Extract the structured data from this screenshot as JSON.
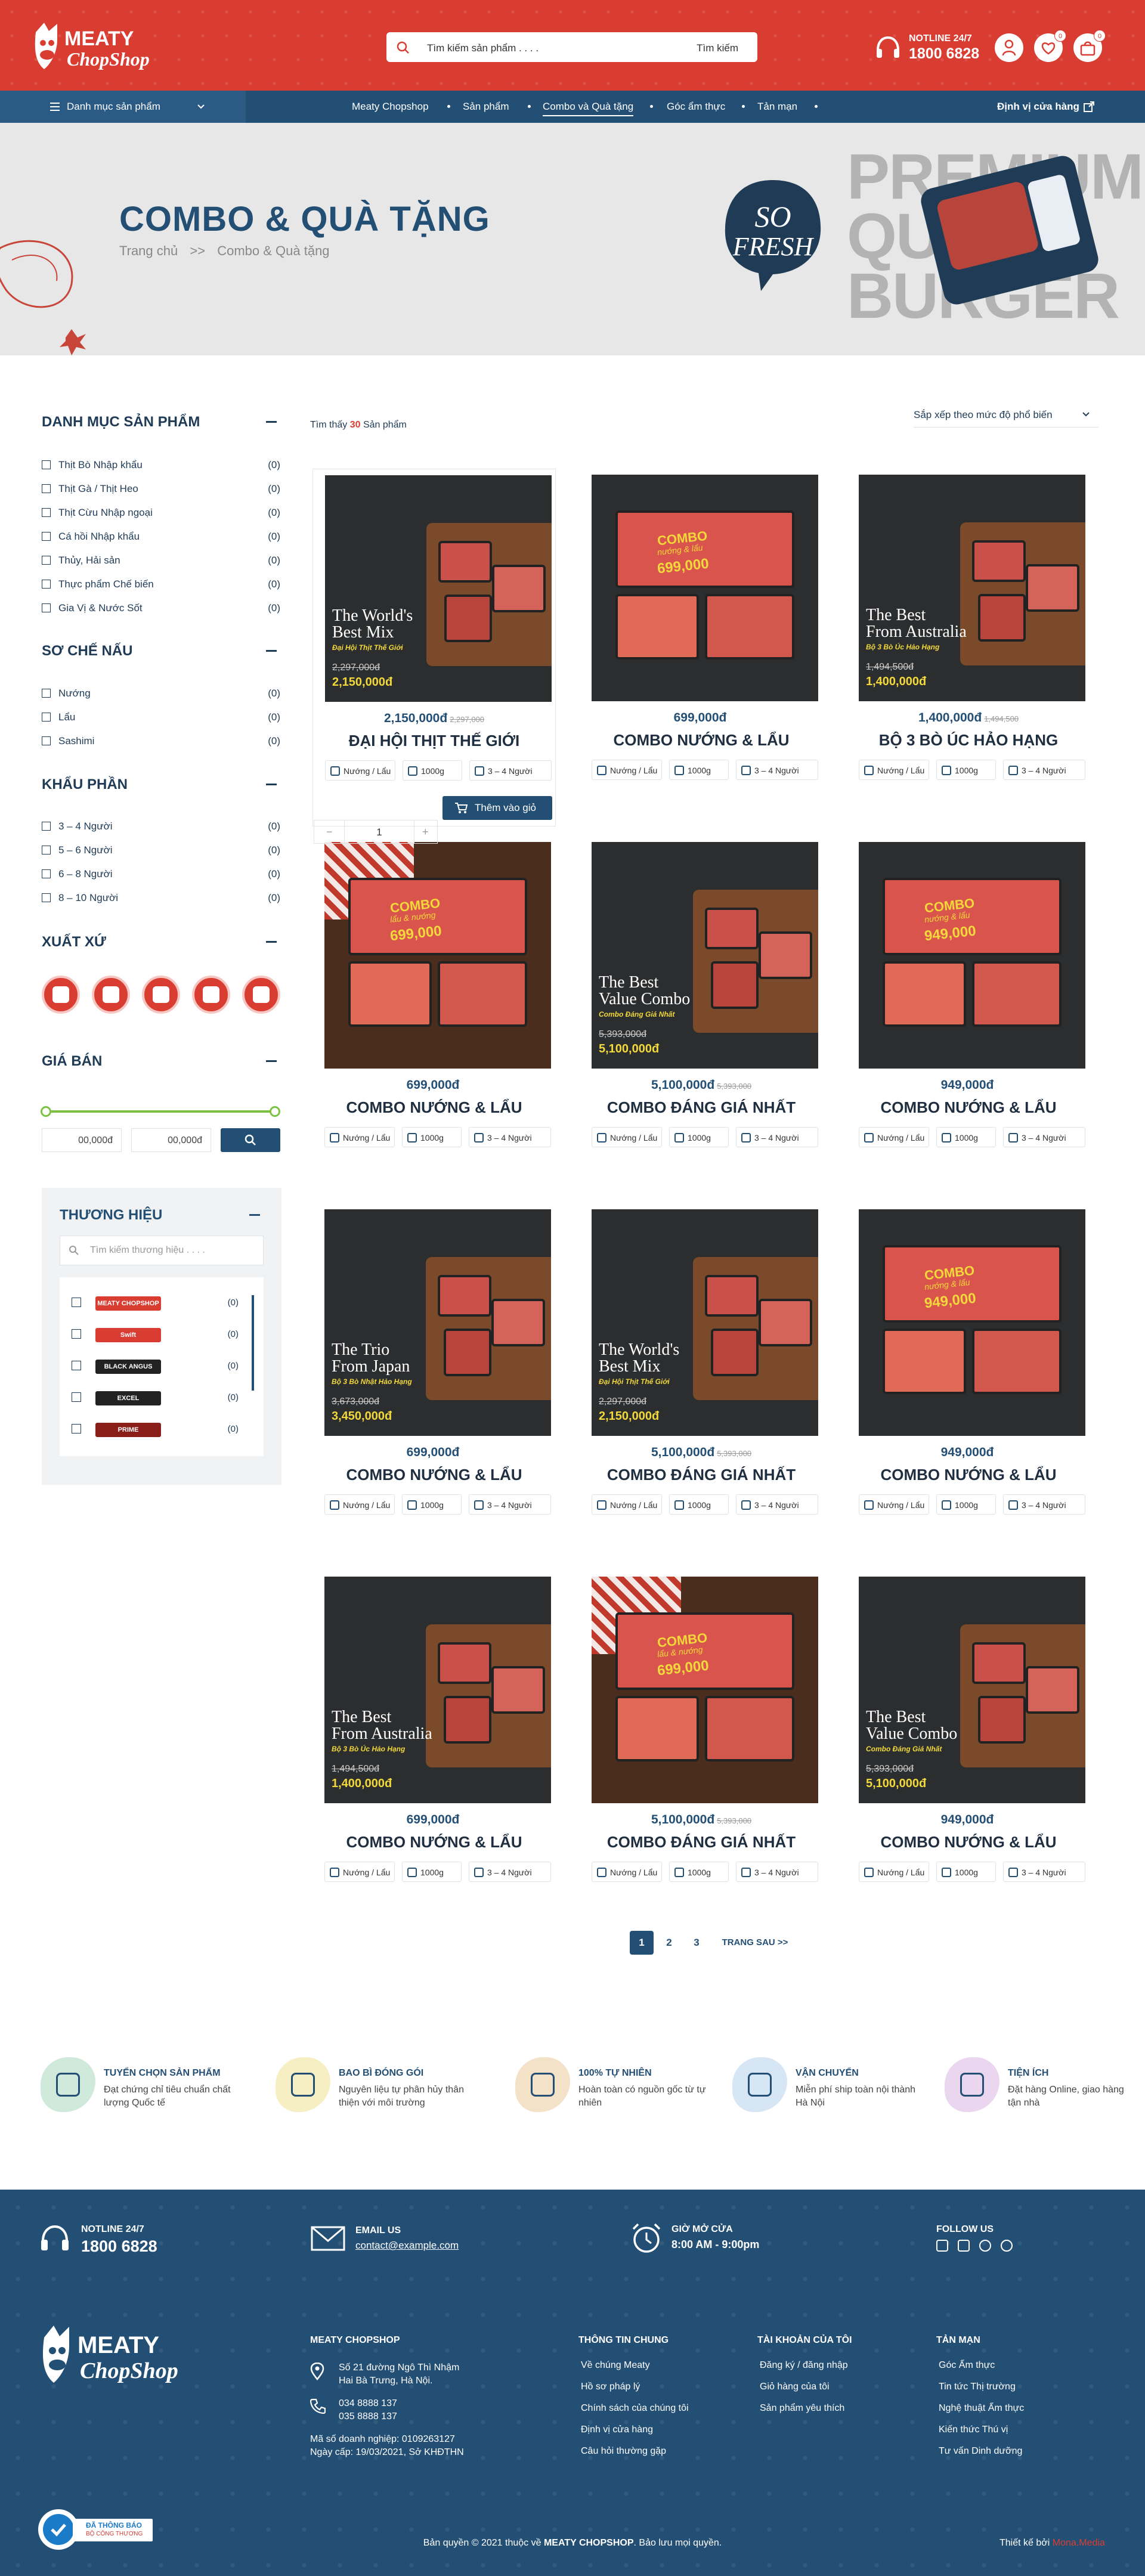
{
  "header": {
    "search_placeholder": "Tìm kiếm sản phẩm . . . .",
    "search_button": "Tìm kiếm",
    "hotline_label": "NOTLINE 24/7",
    "hotline_number": "1800 6828",
    "wishlist_count": "0",
    "cart_count": "0"
  },
  "nav": {
    "category_menu": "Danh mục sản phẩm",
    "items": [
      "Meaty Chopshop",
      "Sản phẩm",
      "Combo và Quà tặng",
      "Góc ẩm thực",
      "Tản mạn"
    ],
    "store_locator": "Định vị cửa hàng"
  },
  "banner": {
    "title": "COMBO & QUÀ TẶNG",
    "breadcrumb_home": "Trang chủ",
    "breadcrumb_sep": ">>",
    "breadcrumb_current": "Combo & Quà tặng",
    "premium_text": [
      "PREMIUM",
      "QUA",
      "BURGER"
    ],
    "badge_text": [
      "SO",
      "FRESH"
    ]
  },
  "sidebar": {
    "categories_title": "DANH MỤC SẢN PHẨM",
    "categories": [
      {
        "label": "Thịt Bò Nhập khẩu",
        "count": "(0)"
      },
      {
        "label": "Thịt Gà / Thịt Heo",
        "count": "(0)"
      },
      {
        "label": "Thịt Cừu Nhập ngoại",
        "count": "(0)"
      },
      {
        "label": "Cá hồi Nhập khẩu",
        "count": "(0)"
      },
      {
        "label": "Thủy, Hải sản",
        "count": "(0)"
      },
      {
        "label": "Thực phẩm Chế biến",
        "count": "(0)"
      },
      {
        "label": "Gia Vị & Nước Sốt",
        "count": "(0)"
      }
    ],
    "prep_title": "SƠ CHẾ NẤU",
    "prep": [
      {
        "label": "Nướng",
        "count": "(0)"
      },
      {
        "label": "Lẩu",
        "count": "(0)"
      },
      {
        "label": "Sashimi",
        "count": "(0)"
      }
    ],
    "portion_title": "KHẨU PHẦN",
    "portions": [
      {
        "label": "3 – 4 Người",
        "count": "(0)"
      },
      {
        "label": "5 – 6 Người",
        "count": "(0)"
      },
      {
        "label": "6 – 8 Người",
        "count": "(0)"
      },
      {
        "label": "8 – 10 Người",
        "count": "(0)"
      }
    ],
    "origin_title": "XUẤT XỨ",
    "price_title": "GIÁ BÁN",
    "price_min": "00,000",
    "price_max": "00,000",
    "currency": "đ",
    "brand_title": "THƯƠNG HIỆU",
    "brand_search_placeholder": "Tìm kiếm thương hiệu . . . .",
    "brands": [
      {
        "name": "MEATY CHOPSHOP",
        "count": "(0)"
      },
      {
        "name": "Swift",
        "count": "(0)"
      },
      {
        "name": "BLACK ANGUS",
        "count": "(0)"
      },
      {
        "name": "EXCEL",
        "count": "(0)"
      },
      {
        "name": "PRIME",
        "count": "(0)"
      }
    ]
  },
  "listing": {
    "found_prefix": "Tìm thấy",
    "found_count": "30",
    "found_suffix": "Sản phẩm",
    "sort_label": "Sắp xếp theo mức độ phổ biến"
  },
  "products": [
    {
      "name": "ĐẠI HỘI THỊT THẾ GIỚI",
      "price": "2,150,000đ",
      "old_price": "2,297,000",
      "img_title": [
        "The World's",
        "Best Mix"
      ],
      "img_sub": "Đại Hội Thịt Thế Giới",
      "img_price_old": "2,297,000đ",
      "img_price": "2,150,000đ",
      "style": "board"
    },
    {
      "name": "COMBO NƯỚNG & LẨU",
      "price": "699,000đ",
      "old_price": "",
      "img_title": [
        "COMBO",
        "nướng & lẩu"
      ],
      "img_sub": "",
      "img_price_old": "",
      "img_price": "699,000",
      "style": "tray"
    },
    {
      "name": "BỘ 3 BÒ ÚC HẢO HẠNG",
      "price": "1,400,000đ",
      "old_price": "1,494,500",
      "img_title": [
        "The Best",
        "From Australia"
      ],
      "img_sub": "Bộ 3 Bò Úc Hảo Hạng",
      "img_price_old": "1,494,500đ",
      "img_price": "1,400,000đ",
      "style": "board"
    },
    {
      "name": "COMBO NƯỚNG & LẨU",
      "price": "699,000đ",
      "old_price": "",
      "img_title": [
        "COMBO",
        "lẩu & nướng"
      ],
      "img_sub": "",
      "img_price_old": "",
      "img_price": "699,000",
      "style": "wood"
    },
    {
      "name": "COMBO ĐÁNG GIÁ NHẤT",
      "price": "5,100,000đ",
      "old_price": "5,393,000",
      "img_title": [
        "The Best",
        "Value Combo"
      ],
      "img_sub": "Combo Đáng Giá Nhất",
      "img_price_old": "5,393,000đ",
      "img_price": "5,100,000đ",
      "style": "board"
    },
    {
      "name": "COMBO NƯỚNG & LẨU",
      "price": "949,000đ",
      "old_price": "",
      "img_title": [
        "COMBO",
        "nướng & lẩu"
      ],
      "img_sub": "",
      "img_price_old": "",
      "img_price": "949,000",
      "style": "tray"
    },
    {
      "name": "COMBO NƯỚNG & LẨU",
      "price": "699,000đ",
      "old_price": "",
      "img_title": [
        "The Trio",
        "From Japan"
      ],
      "img_sub": "Bộ 3 Bò Nhật Hảo Hạng",
      "img_price_old": "3,673,000đ",
      "img_price": "3,450,000đ",
      "style": "board"
    },
    {
      "name": "COMBO ĐÁNG GIÁ NHẤT",
      "price": "5,100,000đ",
      "old_price": "5,393,000",
      "img_title": [
        "The World's",
        "Best Mix"
      ],
      "img_sub": "Đại Hội Thịt Thế Giới",
      "img_price_old": "2,297,000đ",
      "img_price": "2,150,000đ",
      "style": "board"
    },
    {
      "name": "COMBO NƯỚNG & LẨU",
      "price": "949,000đ",
      "old_price": "",
      "img_title": [
        "COMBO",
        "nướng & lẩu"
      ],
      "img_sub": "",
      "img_price_old": "",
      "img_price": "949,000",
      "style": "tray"
    },
    {
      "name": "COMBO NƯỚNG & LẨU",
      "price": "699,000đ",
      "old_price": "",
      "img_title": [
        "The Best",
        "From Australia"
      ],
      "img_sub": "Bộ 3 Bò Úc Hảo Hạng",
      "img_price_old": "1,494,500đ",
      "img_price": "1,400,000đ",
      "style": "board"
    },
    {
      "name": "COMBO ĐÁNG GIÁ NHẤT",
      "price": "5,100,000đ",
      "old_price": "5,393,000",
      "img_title": [
        "COMBO",
        "lẩu & nướng"
      ],
      "img_sub": "",
      "img_price_old": "",
      "img_price": "699,000",
      "style": "wood"
    },
    {
      "name": "COMBO NƯỚNG & LẨU",
      "price": "949,000đ",
      "old_price": "",
      "img_title": [
        "The Best",
        "Value Combo"
      ],
      "img_sub": "Combo Đáng Giá Nhất",
      "img_price_old": "5,393,000đ",
      "img_price": "5,100,000đ",
      "style": "board"
    }
  ],
  "product_tags": {
    "cook": "Nướng / Lẩu",
    "weight": "1000g",
    "people": "3 – 4 Người"
  },
  "cart": {
    "qty": "1",
    "minus": "−",
    "plus": "+",
    "add_label": "Thêm vào giỏ"
  },
  "pagination": {
    "pages": [
      "1",
      "2",
      "3"
    ],
    "next": "TRANG SAU >>"
  },
  "features": [
    {
      "title": "TUYỂN CHỌN SẢN PHẨM",
      "desc": "Đạt chứng chỉ tiêu chuẩn chất lượng Quốc tế",
      "color": "#cfe9da"
    },
    {
      "title": "BAO BÌ ĐÓNG GÓI",
      "desc": "Nguyên liệu tự phân hủy thân thiện với môi trường",
      "color": "#f6efc4"
    },
    {
      "title": "100% TỰ NHIÊN",
      "desc": "Hoàn toàn có nguồn gốc từ tự nhiên",
      "color": "#f3e2c8"
    },
    {
      "title": "VẬN CHUYỂN",
      "desc": "Miễn phí ship toàn nội thành Hà Nội",
      "color": "#d6e6f4"
    },
    {
      "title": "TIỆN ÍCH",
      "desc": "Đặt hàng Online, giao hàng tận nhà",
      "color": "#ead6ef"
    }
  ],
  "footer": {
    "hotline_label": "NOTLINE 24/7",
    "hotline": "1800 6828",
    "email_label": "EMAIL US",
    "email": "contact@example.com",
    "hours_label": "GIỜ MỞ CỬA",
    "hours": "8:00 AM - 9:00pm",
    "follow_label": "FOLLOW US",
    "company_title": "MEATY CHOPSHOP",
    "address": [
      "Số 21 đường Ngô Thì Nhậm",
      "Hai Bà Trưng, Hà Nội."
    ],
    "phones": [
      "034 8888 137",
      "035 8888 137"
    ],
    "tax": "Mã số doanh nghiệp: 0109263127",
    "issued": "Ngày cấp: 19/03/2021, Sở KHĐTHN",
    "col_info_title": "THÔNG TIN CHUNG",
    "col_info": [
      "Về chúng Meaty",
      "Hồ sơ pháp lý",
      "Chính sách của chúng tôi",
      "Định vị cửa hàng",
      "Câu hỏi thường gặp"
    ],
    "col_account_title": "TÀI KHOẢN CỦA TÔI",
    "col_account": [
      "Đăng ký / đăng nhập",
      "Giỏ hàng của tôi",
      "Sản phẩm yêu thích"
    ],
    "col_blog_title": "TẢN MẠN",
    "col_blog": [
      "Góc Ẩm thực",
      "Tin tức Thị trường",
      "Nghệ thuật Ẩm thực",
      "Kiến thức Thú vị",
      "Tư vấn Dinh dưỡng"
    ],
    "copyright_pre": "Bản quyền © 2021 thuộc về",
    "copyright_brand": "MEATY CHOPSHOP",
    "copyright_post": ". Bảo lưu mọi quyền.",
    "design_by": "Thiết kế bởi",
    "designer": "Mona.Media",
    "cert_line1": "ĐÃ THÔNG BÁO",
    "cert_line2": "BỘ CÔNG THƯƠNG"
  },
  "colors": {
    "brand_red": "#d93d32",
    "navy": "#244f74",
    "green": "#7cc142"
  }
}
